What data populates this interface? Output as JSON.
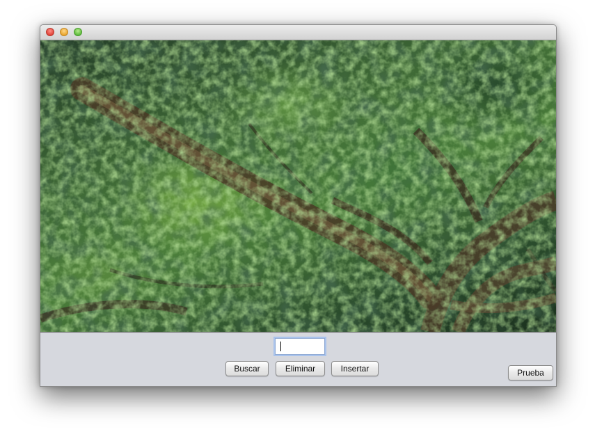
{
  "window": {
    "title": "",
    "controls": [
      "close-icon",
      "minimize-icon",
      "zoom-icon"
    ]
  },
  "image": {
    "description_icon": "tree-canopy-photo"
  },
  "form": {
    "input_value": "",
    "buttons": {
      "buscar": "Buscar",
      "eliminar": "Eliminar",
      "insertar": "Insertar",
      "prueba": "Prueba"
    }
  },
  "colors": {
    "panel_bg": "#d6d8de",
    "focus_ring": "#a9c3ec"
  }
}
